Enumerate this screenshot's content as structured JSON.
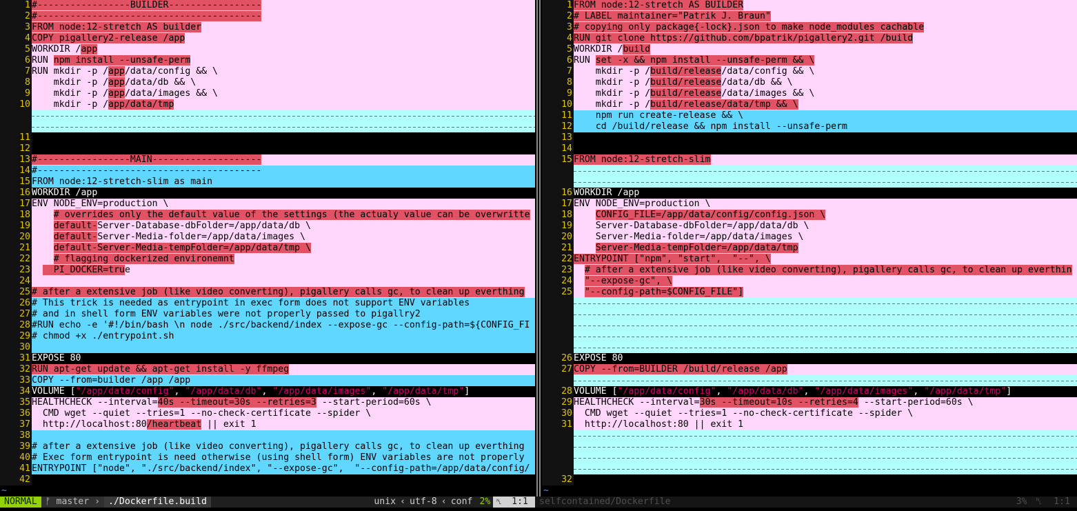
{
  "left_pane": {
    "lines": [
      {
        "n": "1",
        "k": "change",
        "s": [
          [
            "#-----------------BUILDER-----------------",
            "h"
          ]
        ]
      },
      {
        "n": "2",
        "k": "change",
        "s": [
          [
            "#-----------------------------------------",
            "h"
          ]
        ]
      },
      {
        "n": "3",
        "k": "change",
        "s": [
          [
            "FROM node:12-stretch AS builder",
            "h"
          ]
        ]
      },
      {
        "n": "4",
        "k": "change",
        "s": [
          [
            "COPY pigallery2-release /app",
            "h"
          ]
        ]
      },
      {
        "n": "5",
        "k": "change",
        "s": [
          [
            "WORKDIR /",
            ""
          ],
          [
            "app",
            "h"
          ]
        ]
      },
      {
        "n": "6",
        "k": "change",
        "s": [
          [
            "RUN ",
            ""
          ],
          [
            "npm install --unsafe-perm",
            "h"
          ]
        ]
      },
      {
        "n": "7",
        "k": "change",
        "s": [
          [
            "RUN mkdir -p /",
            ""
          ],
          [
            "app",
            "h"
          ],
          [
            "/data/config && \\",
            ""
          ]
        ]
      },
      {
        "n": "8",
        "k": "change",
        "s": [
          [
            "    mkdir -p /",
            ""
          ],
          [
            "app",
            "h"
          ],
          [
            "/data/db && \\",
            ""
          ]
        ]
      },
      {
        "n": "9",
        "k": "change",
        "s": [
          [
            "    mkdir -p /",
            ""
          ],
          [
            "app",
            "h"
          ],
          [
            "/data/images && \\",
            ""
          ]
        ]
      },
      {
        "n": "10",
        "k": "change",
        "s": [
          [
            "    mkdir -p /",
            ""
          ],
          [
            "app/data/tmp",
            "h"
          ]
        ]
      },
      {
        "n": "",
        "k": "filler",
        "s": [
          [
            "-",
            ""
          ]
        ]
      },
      {
        "n": "",
        "k": "filler",
        "s": [
          [
            "-",
            ""
          ]
        ]
      },
      {
        "n": "11",
        "k": "plain",
        "s": [
          [
            "",
            ""
          ]
        ]
      },
      {
        "n": "12",
        "k": "plain",
        "s": [
          [
            "",
            ""
          ]
        ]
      },
      {
        "n": "13",
        "k": "change",
        "s": [
          [
            "#-----------------MAIN--------------------",
            "h"
          ]
        ]
      },
      {
        "n": "14",
        "k": "add",
        "s": [
          [
            "#-----------------------------------------",
            ""
          ]
        ]
      },
      {
        "n": "15",
        "k": "add",
        "s": [
          [
            "FROM node:12-stretch-slim as main",
            ""
          ]
        ]
      },
      {
        "n": "16",
        "k": "plain",
        "s": [
          [
            "WORKDIR /app",
            ""
          ]
        ]
      },
      {
        "n": "17",
        "k": "change",
        "s": [
          [
            "ENV NODE_ENV=production \\",
            ""
          ]
        ]
      },
      {
        "n": "18",
        "k": "change",
        "s": [
          [
            "    ",
            ""
          ],
          [
            "# overrides only the default value of the settings (the actualy value can be overwritte",
            "h"
          ]
        ]
      },
      {
        "n": "19",
        "k": "change",
        "s": [
          [
            "    ",
            ""
          ],
          [
            "default-",
            "h"
          ],
          [
            "Server-Database-dbFolder=/app/data/db \\",
            ""
          ]
        ]
      },
      {
        "n": "20",
        "k": "change",
        "s": [
          [
            "    ",
            ""
          ],
          [
            "default-",
            "h"
          ],
          [
            "Server-Media-folder=/app/data/images \\",
            ""
          ]
        ]
      },
      {
        "n": "21",
        "k": "change",
        "s": [
          [
            "    ",
            ""
          ],
          [
            "default-Server-Media-tempFolder=/app/data/tmp \\",
            "h"
          ]
        ]
      },
      {
        "n": "22",
        "k": "change",
        "s": [
          [
            "    ",
            ""
          ],
          [
            "# flagging dockerized environemnt",
            "h"
          ]
        ]
      },
      {
        "n": "23",
        "k": "change",
        "s": [
          [
            "  ",
            ""
          ],
          [
            "  PI_DOCKER=tru",
            "h"
          ],
          [
            "e",
            ""
          ]
        ]
      },
      {
        "n": "24",
        "k": "change",
        "s": [
          [
            "",
            ""
          ]
        ]
      },
      {
        "n": "25",
        "k": "change",
        "s": [
          [
            "# after a extensive job (like video converting), pigallery calls gc, to clean up everthing",
            "h"
          ]
        ]
      },
      {
        "n": "26",
        "k": "add",
        "s": [
          [
            "# This trick is needed as entrypoint in exec form does not support ENV variables",
            ""
          ]
        ]
      },
      {
        "n": "27",
        "k": "add",
        "s": [
          [
            "# and in shell form ENV variables were not properly passed to pigallry2",
            ""
          ]
        ]
      },
      {
        "n": "28",
        "k": "add",
        "s": [
          [
            "#RUN echo -e '#!/bin/bash \\n node ./src/backend/index --expose-gc --config-path=${CONFIG_FI",
            ""
          ]
        ]
      },
      {
        "n": "29",
        "k": "add",
        "s": [
          [
            "# chmod +x ./entrypoint.sh",
            ""
          ]
        ]
      },
      {
        "n": "30",
        "k": "add",
        "s": [
          [
            "",
            ""
          ]
        ]
      },
      {
        "n": "31",
        "k": "plain",
        "s": [
          [
            "EXPOSE 80",
            ""
          ]
        ]
      },
      {
        "n": "32",
        "k": "change",
        "s": [
          [
            "RUN apt-get update && apt-get install -y ffmpeg",
            "h"
          ]
        ]
      },
      {
        "n": "33",
        "k": "add",
        "s": [
          [
            "COPY --from=builder /app /app",
            ""
          ]
        ]
      },
      {
        "n": "34",
        "k": "plain",
        "s": [
          [
            "VOLUME [",
            ""
          ],
          [
            "\"/app/data/config\"",
            "q"
          ],
          [
            ", ",
            ""
          ],
          [
            "\"/app/data/db\"",
            "q"
          ],
          [
            ", ",
            ""
          ],
          [
            "\"/app/data/images\"",
            "q"
          ],
          [
            ", ",
            ""
          ],
          [
            "\"/app/data/tmp\"",
            "q"
          ],
          [
            "]",
            ""
          ]
        ]
      },
      {
        "n": "35",
        "k": "change",
        "s": [
          [
            "HEALTHCHECK --interval=",
            ""
          ],
          [
            "40s --timeout=30s --retries=3",
            "h"
          ],
          [
            " --start-period=60s \\",
            ""
          ]
        ]
      },
      {
        "n": "36",
        "k": "change",
        "s": [
          [
            "  CMD wget --quiet --tries=1 --no-check-certificate --spider \\",
            ""
          ]
        ]
      },
      {
        "n": "37",
        "k": "change",
        "s": [
          [
            "  http://localhost:80",
            ""
          ],
          [
            "/heartbeat",
            "h"
          ],
          [
            " || exit 1",
            ""
          ]
        ]
      },
      {
        "n": "38",
        "k": "add",
        "s": [
          [
            "",
            ""
          ]
        ]
      },
      {
        "n": "39",
        "k": "add",
        "s": [
          [
            "# after a extensive job (like video converting), pigallery calls gc, to clean up everthing",
            ""
          ]
        ]
      },
      {
        "n": "40",
        "k": "add",
        "s": [
          [
            "# Exec form entrypoint is need otherwise (using shell form) ENV variables are not properly",
            ""
          ]
        ]
      },
      {
        "n": "41",
        "k": "add",
        "s": [
          [
            "ENTRYPOINT [\"node\", \"./src/backend/index\", \"--expose-gc\",  \"--config-path=/app/data/config/",
            ""
          ]
        ]
      },
      {
        "n": "42",
        "k": "plain",
        "s": [
          [
            "",
            ""
          ]
        ]
      }
    ]
  },
  "right_pane": {
    "lines": [
      {
        "n": "1",
        "k": "change",
        "s": [
          [
            "FROM node:12-stretch AS BUILDER",
            "h"
          ]
        ]
      },
      {
        "n": "2",
        "k": "change",
        "s": [
          [
            "# LABEL maintainer=\"Patrik J. Braun\"",
            "h"
          ]
        ]
      },
      {
        "n": "3",
        "k": "change",
        "s": [
          [
            "# copying only package{-lock}.json to make node_modules cachable",
            "h"
          ]
        ]
      },
      {
        "n": "4",
        "k": "change",
        "s": [
          [
            "RUN git clone https://github.com/bpatrik/pigallery2.git /build",
            "h"
          ]
        ]
      },
      {
        "n": "5",
        "k": "change",
        "s": [
          [
            "WORKDIR /",
            ""
          ],
          [
            "build",
            "h"
          ]
        ]
      },
      {
        "n": "6",
        "k": "change",
        "s": [
          [
            "RUN ",
            ""
          ],
          [
            "set -x && npm install --unsafe-perm && \\",
            "h"
          ]
        ]
      },
      {
        "n": "7",
        "k": "change",
        "s": [
          [
            "    mkdir -p /",
            ""
          ],
          [
            "build/release",
            "h"
          ],
          [
            "/data/config && \\",
            ""
          ]
        ]
      },
      {
        "n": "8",
        "k": "change",
        "s": [
          [
            "    mkdir -p /",
            ""
          ],
          [
            "build/release",
            "h"
          ],
          [
            "/data/db && \\",
            ""
          ]
        ]
      },
      {
        "n": "9",
        "k": "change",
        "s": [
          [
            "    mkdir -p /",
            ""
          ],
          [
            "build/release",
            "h"
          ],
          [
            "/data/images && \\",
            ""
          ]
        ]
      },
      {
        "n": "10",
        "k": "change",
        "s": [
          [
            "    mkdir -p /",
            ""
          ],
          [
            "build/release/data/tmp && \\",
            "h"
          ]
        ]
      },
      {
        "n": "11",
        "k": "add",
        "s": [
          [
            "    npm run create-release && \\",
            ""
          ]
        ]
      },
      {
        "n": "12",
        "k": "add",
        "s": [
          [
            "    cd /build/release && npm install --unsafe-perm",
            ""
          ]
        ]
      },
      {
        "n": "13",
        "k": "plain",
        "s": [
          [
            "",
            ""
          ]
        ]
      },
      {
        "n": "14",
        "k": "plain",
        "s": [
          [
            "",
            ""
          ]
        ]
      },
      {
        "n": "15",
        "k": "change",
        "s": [
          [
            "FROM node:12-stretch-slim",
            "h"
          ]
        ]
      },
      {
        "n": "",
        "k": "filler",
        "s": [
          [
            "-",
            ""
          ]
        ]
      },
      {
        "n": "",
        "k": "filler",
        "s": [
          [
            "-",
            ""
          ]
        ]
      },
      {
        "n": "16",
        "k": "plain",
        "s": [
          [
            "WORKDIR /app",
            ""
          ]
        ]
      },
      {
        "n": "17",
        "k": "change",
        "s": [
          [
            "ENV NODE_ENV=production \\",
            ""
          ]
        ]
      },
      {
        "n": "18",
        "k": "change",
        "s": [
          [
            "    ",
            ""
          ],
          [
            "CONFIG_FILE=/app/data/config/config.json \\",
            "h"
          ]
        ]
      },
      {
        "n": "19",
        "k": "change",
        "s": [
          [
            "    Server-Database-dbFolder=/app/data/db \\",
            ""
          ]
        ]
      },
      {
        "n": "20",
        "k": "change",
        "s": [
          [
            "    Server-Media-folder=/app/data/images \\",
            ""
          ]
        ]
      },
      {
        "n": "21",
        "k": "change",
        "s": [
          [
            "    ",
            ""
          ],
          [
            "Server-Media-tempFolder=/app/data/tmp",
            "h"
          ]
        ]
      },
      {
        "n": "22",
        "k": "change",
        "s": [
          [
            "ENTRYPOINT [\"npm\", \"start\",  \"--\", \\",
            "h"
          ]
        ]
      },
      {
        "n": "23",
        "k": "change",
        "s": [
          [
            "  ",
            ""
          ],
          [
            "# after a extensive job (like video converting), pigallery calls gc, to clean up everthin",
            "h"
          ]
        ]
      },
      {
        "n": "24",
        "k": "change",
        "s": [
          [
            "  ",
            ""
          ],
          [
            "\"--expose-gc\", \\",
            "h"
          ]
        ]
      },
      {
        "n": "25",
        "k": "change",
        "s": [
          [
            "  ",
            ""
          ],
          [
            "\"--config-path=$CONFIG_FILE\"]",
            "h"
          ]
        ]
      },
      {
        "n": "",
        "k": "filler",
        "s": [
          [
            "-",
            ""
          ]
        ]
      },
      {
        "n": "",
        "k": "filler",
        "s": [
          [
            "-",
            ""
          ]
        ]
      },
      {
        "n": "",
        "k": "filler",
        "s": [
          [
            "-",
            ""
          ]
        ]
      },
      {
        "n": "",
        "k": "filler",
        "s": [
          [
            "-",
            ""
          ]
        ]
      },
      {
        "n": "",
        "k": "filler",
        "s": [
          [
            "-",
            ""
          ]
        ]
      },
      {
        "n": "26",
        "k": "plain",
        "s": [
          [
            "EXPOSE 80",
            ""
          ]
        ]
      },
      {
        "n": "27",
        "k": "change",
        "s": [
          [
            "COPY --from=BUILDER /build/release /app",
            "h"
          ]
        ]
      },
      {
        "n": "",
        "k": "filler",
        "s": [
          [
            "-",
            ""
          ]
        ]
      },
      {
        "n": "28",
        "k": "plain",
        "s": [
          [
            "VOLUME [",
            ""
          ],
          [
            "\"/app/data/config\"",
            "q"
          ],
          [
            ", ",
            ""
          ],
          [
            "\"/app/data/db\"",
            "q"
          ],
          [
            ", ",
            ""
          ],
          [
            "\"/app/data/images\"",
            "q"
          ],
          [
            ", ",
            ""
          ],
          [
            "\"/app/data/tmp\"",
            "q"
          ],
          [
            "]",
            ""
          ]
        ]
      },
      {
        "n": "29",
        "k": "change",
        "s": [
          [
            "HEALTHCHECK --interval=",
            ""
          ],
          [
            "30s --timeout=10s --retries=4",
            "h"
          ],
          [
            " --start-period=60s \\",
            ""
          ]
        ]
      },
      {
        "n": "30",
        "k": "change",
        "s": [
          [
            "  CMD wget --quiet --tries=1 --no-check-certificate --spider \\",
            ""
          ]
        ]
      },
      {
        "n": "31",
        "k": "change",
        "s": [
          [
            "  http://localhost:80 || exit 1",
            ""
          ]
        ]
      },
      {
        "n": "",
        "k": "filler",
        "s": [
          [
            "-",
            ""
          ]
        ]
      },
      {
        "n": "",
        "k": "filler",
        "s": [
          [
            "-",
            ""
          ]
        ]
      },
      {
        "n": "",
        "k": "filler",
        "s": [
          [
            "-",
            ""
          ]
        ]
      },
      {
        "n": "",
        "k": "filler",
        "s": [
          [
            "-",
            ""
          ]
        ]
      },
      {
        "n": "32",
        "k": "plain",
        "s": [
          [
            "",
            ""
          ]
        ]
      }
    ]
  },
  "status_left": {
    "mode": "NORMAL",
    "branch_icon": "ᚠ",
    "branch": "master",
    "filename": "./Dockerfile.build",
    "fileformat": "unix",
    "encoding": "utf-8",
    "filetype": "conf",
    "percent": "2%",
    "ln_icon": "␤",
    "position": "1:1"
  },
  "status_right": {
    "filename": "selfcontained/Dockerfile",
    "percent": "3%",
    "ln_icon": "␤",
    "position": "1:1"
  },
  "tilde": "~",
  "colors": {
    "change_bg": "#ffd6fb",
    "add_bg": "#5fd7ff",
    "text_highlight": "#e05264",
    "quote_string": "#d1006b",
    "gutter_fg": "#e2c400",
    "mode_bg": "#95d300"
  }
}
